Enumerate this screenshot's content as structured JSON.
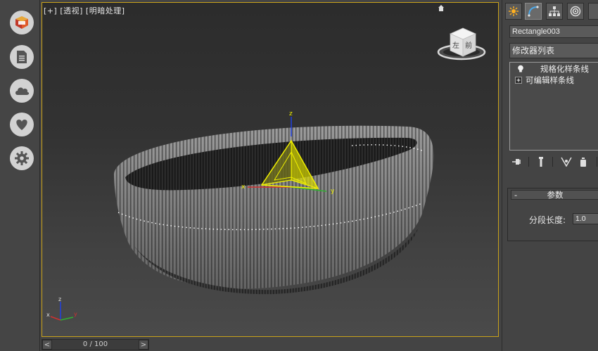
{
  "viewport": {
    "label_plus": "[+]",
    "label_view": "[透视]",
    "label_shading": "[明暗处理]",
    "viewcube_left": "左",
    "viewcube_front": "前",
    "gizmo_x": "x",
    "gizmo_y": "y",
    "gizmo_z": "z",
    "triad_x": "x",
    "triad_y": "y",
    "triad_z": "z"
  },
  "timeline": {
    "counter": "0 / 100",
    "prev": "<",
    "next": ">"
  },
  "left_dock": {
    "icons": [
      "3dsmax-logo-icon",
      "document-icon",
      "cloud-icon",
      "heart-icon",
      "gear-icon"
    ]
  },
  "command_panel": {
    "tabs": [
      "create-tab",
      "modify-tab",
      "hierarchy-tab",
      "motion-tab"
    ],
    "object_name": "Rectangle003",
    "modifier_list": "修改器列表",
    "stack": [
      {
        "label": "规格化样条线",
        "icon": "lightbulb-icon"
      },
      {
        "label": "可编辑样条线",
        "icon": "expand-plus-icon"
      }
    ],
    "params": {
      "toggle": "-",
      "title": "参数",
      "segment_length_label": "分段长度:",
      "segment_length_value": "1.0"
    }
  },
  "colors": {
    "viewport_border": "#c9a21a",
    "gizmo_yellow": "#f0f000",
    "axis_x": "#d03030",
    "axis_y": "#30b030",
    "axis_z": "#2040e0"
  }
}
